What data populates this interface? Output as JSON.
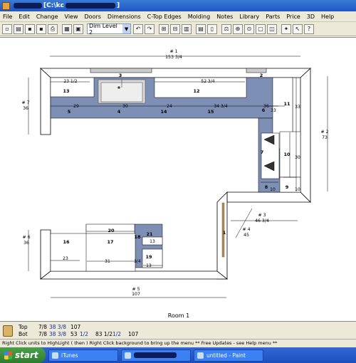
{
  "titlebar": {
    "path_suffix": "[C:\\kc",
    "path_end": "]"
  },
  "menu": [
    "File",
    "Edit",
    "Change",
    "View",
    "Doors",
    "Dimensions",
    "C-Top Edges",
    "Molding",
    "Notes",
    "Library",
    "Parts",
    "Price",
    "3D",
    "Help"
  ],
  "toolbar": {
    "dim_level": "Dim Level 2"
  },
  "plan": {
    "room_label": "Room 1",
    "dims": {
      "d1": "# 1",
      "d1v": "153 3/4",
      "d2": "# 2",
      "d2v": "73",
      "d3": "# 3",
      "d3v": "46 3/4",
      "d4": "# 4",
      "d4v": "45",
      "d5": "# 5",
      "d5v": "107",
      "d6": "# 6",
      "d6v": "36",
      "d7": "# 7",
      "d7v": "36"
    },
    "labels": {
      "n1": "1",
      "n2": "2",
      "n3": "3",
      "n4": "4",
      "n5": "5",
      "n6": "6",
      "n7": "7",
      "n8": "8",
      "n9": "9",
      "n10": "10",
      "n11": "11",
      "n12": "12",
      "n13": "13",
      "n14": "14",
      "n15": "15",
      "n16": "16",
      "n17": "17",
      "n18": "18",
      "n19": "19",
      "n20": "20",
      "n21": "21",
      "w23_5": "23 1/2",
      "w52_75": "52 3/4",
      "w29": "29",
      "w30": "30",
      "w24": "24",
      "w34_75": "34 3/4",
      "w36": "36",
      "w33a": "33",
      "w33b": "33",
      "w30b": "30",
      "w10a": "10",
      "w10b": "10",
      "w13a": "13",
      "w23": "23",
      "w31": "31",
      "w34": "3/4",
      "w13b": "13"
    }
  },
  "status": {
    "top": {
      "label": "Top",
      "a": "7/8",
      "b": "38 3/8",
      "c": "107"
    },
    "bot": {
      "label": "Bot",
      "a": "7/8",
      "b": "38 3/8",
      "c": "53",
      "c2": "1/2",
      "d": "83 1/2",
      "d2": "1/2",
      "e": "107"
    }
  },
  "hint": "Right Click units to HighLight ( then )  Right Click background to bring up the menu       ** Free Updates - see Help menu **",
  "taskbar": {
    "start": "start",
    "tasks": [
      "iTunes",
      "",
      "untitled - Paint"
    ]
  }
}
